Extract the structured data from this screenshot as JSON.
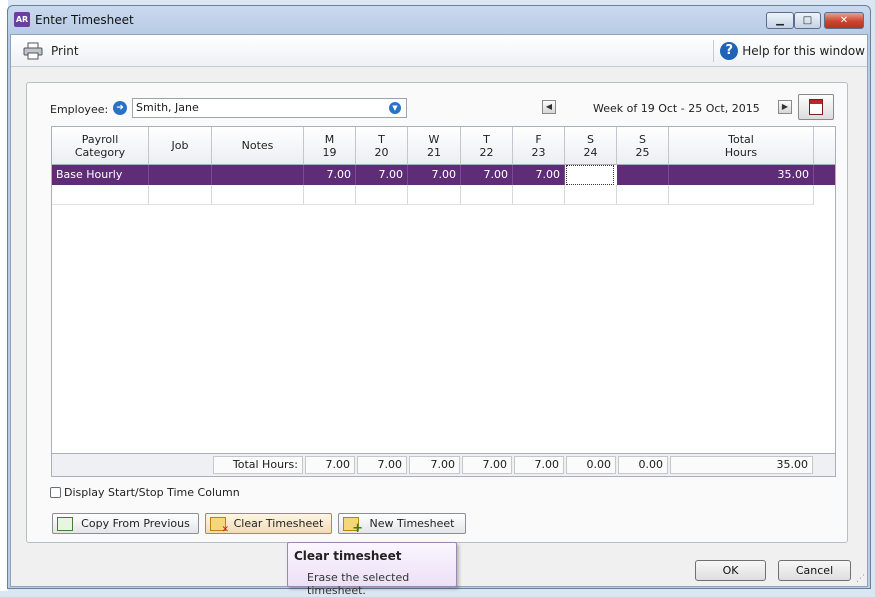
{
  "window": {
    "title": "Enter Timesheet",
    "app_icon_text": "AR",
    "min_symbol": "▁",
    "max_symbol": "□",
    "close_symbol": "✕"
  },
  "toolbar": {
    "print_label": "Print",
    "help_label": "Help for this window",
    "help_icon_text": "?"
  },
  "employee": {
    "label": "Employee:",
    "value": "Smith, Jane"
  },
  "week": {
    "label": "Week of 19 Oct - 25 Oct, 2015",
    "prev_symbol": "◀",
    "next_symbol": "▶"
  },
  "grid": {
    "headers": [
      {
        "line1": "Payroll",
        "line2": "Category"
      },
      {
        "line1": "Job",
        "line2": ""
      },
      {
        "line1": "Notes",
        "line2": ""
      },
      {
        "line1": "M",
        "line2": "19"
      },
      {
        "line1": "T",
        "line2": "20"
      },
      {
        "line1": "W",
        "line2": "21"
      },
      {
        "line1": "T",
        "line2": "22"
      },
      {
        "line1": "F",
        "line2": "23"
      },
      {
        "line1": "S",
        "line2": "24"
      },
      {
        "line1": "S",
        "line2": "25"
      },
      {
        "line1": "Total",
        "line2": "Hours"
      }
    ],
    "rows": [
      {
        "category": "Base Hourly",
        "job": "",
        "notes": "",
        "days": [
          "7.00",
          "7.00",
          "7.00",
          "7.00",
          "7.00",
          "",
          ""
        ],
        "total": "35.00"
      }
    ],
    "footer": {
      "label": "Total Hours:",
      "days": [
        "7.00",
        "7.00",
        "7.00",
        "7.00",
        "7.00",
        "0.00",
        "0.00"
      ],
      "total": "35.00"
    },
    "selected_row_color": "#5f2d77"
  },
  "options": {
    "start_stop_label": "Display Start/Stop Time Column",
    "start_stop_checked": false
  },
  "actions": {
    "copy_label": "Copy From Previous",
    "clear_label": "Clear Timesheet",
    "new_label": "New Timesheet"
  },
  "dialog": {
    "ok_label": "OK",
    "cancel_label": "Cancel"
  },
  "tooltip": {
    "title": "Clear timesheet",
    "body": "Erase the selected timesheet."
  },
  "icons": [
    "printer-icon",
    "help-icon",
    "arrow-right-icon",
    "dropdown-icon",
    "calendar-icon",
    "copy-icon",
    "clear-icon",
    "new-icon"
  ]
}
